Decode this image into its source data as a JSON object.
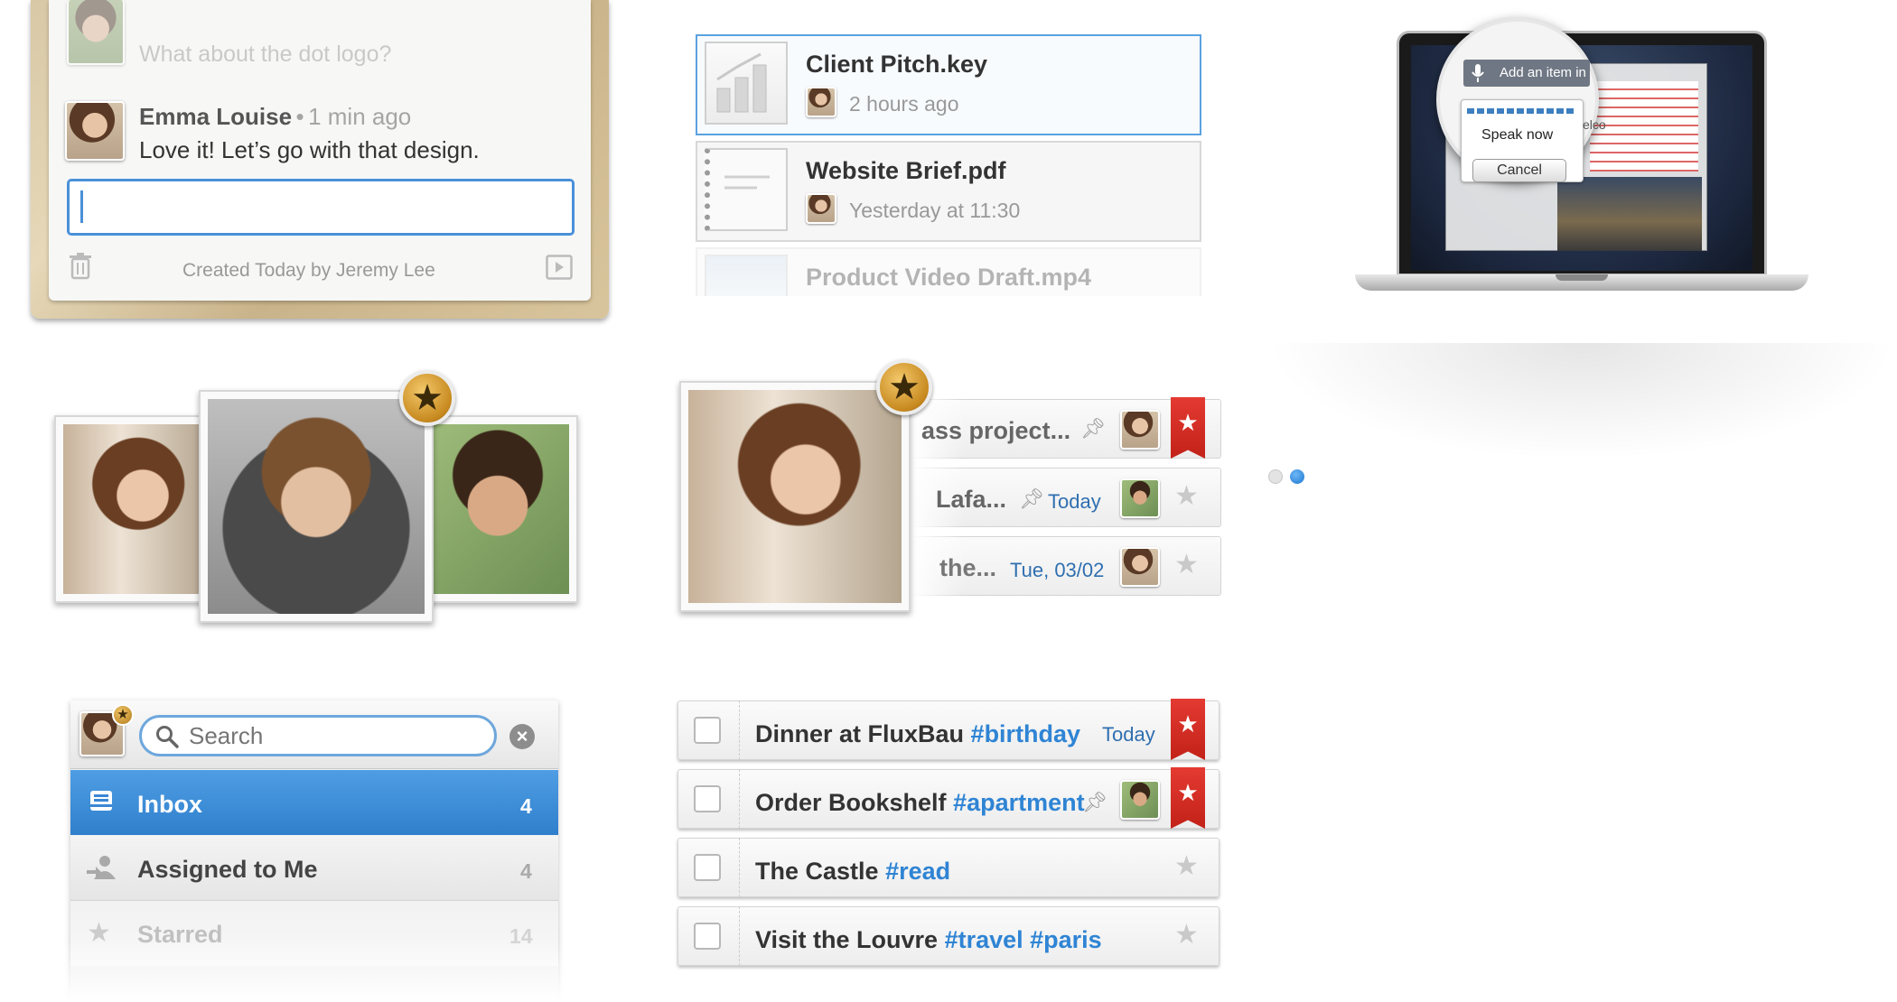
{
  "comments": {
    "ghost_comment": "What about the dot logo?",
    "author": "Emma Louise",
    "separator": "•",
    "time": "1 min ago",
    "message": "Love it! Let’s go with that design.",
    "input_value": "",
    "footer": "Created Today by Jeremy Lee"
  },
  "files": [
    {
      "name": "Client Pitch.key",
      "meta": "2 hours ago"
    },
    {
      "name": "Website Brief.pdf",
      "meta": "Yesterday at 11:30"
    },
    {
      "name": "Product Video Draft.mp4",
      "meta": ""
    }
  ],
  "voice": {
    "bar_text": "Add an item in",
    "speak": "Speak now",
    "cancel": "Cancel",
    "peek_text": "elco"
  },
  "carousel": {
    "active_index": 1,
    "dot_count": 2
  },
  "preview_tasks": [
    {
      "text": "ass project...",
      "date": "",
      "starred": true
    },
    {
      "text": "Lafa...",
      "date": "Today",
      "starred": false
    },
    {
      "text": "the...",
      "date": "Tue, 03/02",
      "starred": false
    }
  ],
  "search": {
    "placeholder": "Search",
    "value": ""
  },
  "sidebar": {
    "items": [
      {
        "label": "Inbox",
        "count": "4"
      },
      {
        "label": "Assigned to Me",
        "count": "4"
      },
      {
        "label": "Starred",
        "count": "14"
      }
    ]
  },
  "tasks": [
    {
      "title": "Dinner at FluxBau",
      "tags": "#birthday",
      "date": "Today",
      "starred": true
    },
    {
      "title": "Order Bookshelf",
      "tags": "#apartment",
      "date": "",
      "starred": true
    },
    {
      "title": "The Castle",
      "tags": "#read",
      "date": "",
      "starred": false
    },
    {
      "title": "Visit the Louvre",
      "tags": "#travel #paris",
      "date": "",
      "starred": false
    }
  ],
  "colors": {
    "accent": "#2f84d4",
    "ribbon": "#d62b22",
    "selection_blue": "#3a8ad8"
  }
}
